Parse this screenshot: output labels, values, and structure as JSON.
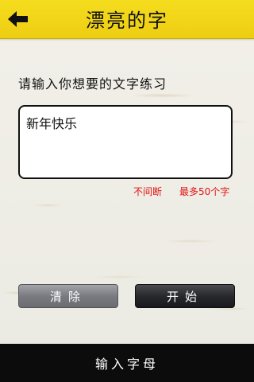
{
  "header": {
    "title": "漂亮的字",
    "back_icon": "arrow-left-icon"
  },
  "main": {
    "prompt": "请输入你想要的文字练习",
    "input_value": "新年快乐",
    "note_no_break": "不间断",
    "note_limit": "最多50个字"
  },
  "buttons": {
    "clear_label": "清除",
    "start_label": "开始"
  },
  "footer": {
    "label": "输入字母"
  },
  "colors": {
    "header_yellow": "#f2d516",
    "note_red": "#e01515",
    "footer_black": "#0c0c0c"
  }
}
